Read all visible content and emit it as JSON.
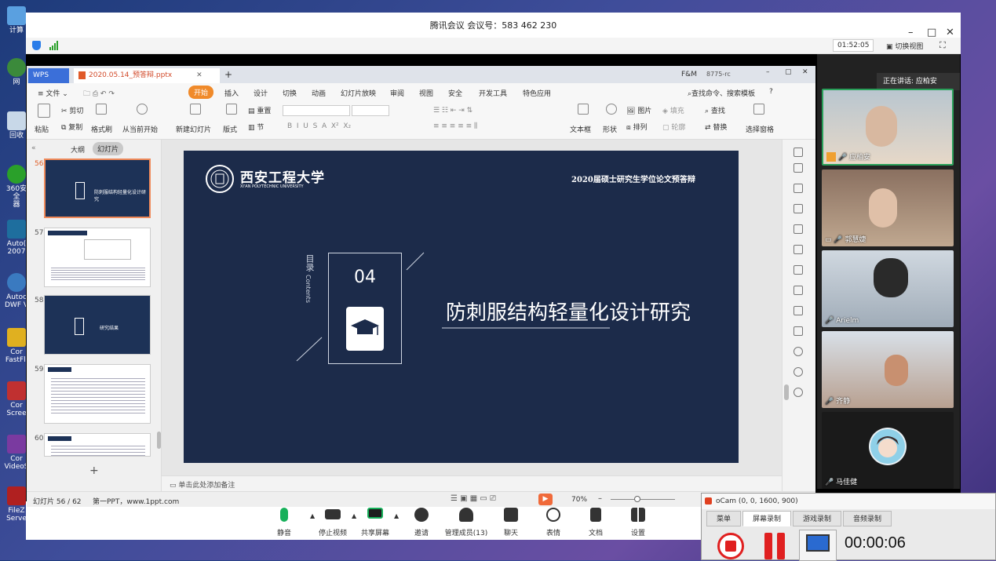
{
  "desktop": {
    "icons": [
      "计算",
      "网",
      "回收",
      "360安全\n器",
      "Auto(\n2007",
      "Autoc\nDWF V",
      "Cor\nFastFli",
      "Cor\nScree",
      "Cor\nVideoS",
      "FileZ\nServe"
    ]
  },
  "meeting": {
    "title": "腾讯会议 会议号：583 462 230",
    "timer": "01:52:05",
    "switch_view": "切换视图",
    "speaking_now": "正在讲话: 应柏安",
    "toolbar": [
      {
        "label": "静音",
        "icon": "microphone-icon"
      },
      {
        "label": "停止视频",
        "icon": "camera-icon"
      },
      {
        "label": "共享屏幕",
        "icon": "share-screen-icon"
      },
      {
        "label": "邀请",
        "icon": "invite-icon"
      },
      {
        "label": "管理成员(13)",
        "icon": "members-icon"
      },
      {
        "label": "聊天",
        "icon": "chat-icon"
      },
      {
        "label": "表情",
        "icon": "emoji-icon"
      },
      {
        "label": "文档",
        "icon": "document-icon"
      },
      {
        "label": "设置",
        "icon": "settings-icon"
      }
    ],
    "participants": [
      "应柏安",
      "郭慧婕",
      "Arielm",
      "齐静",
      "马佳健"
    ]
  },
  "wps": {
    "app_tab": "WPS",
    "file_tab": "2020.05.14_预答辩.pptx",
    "user": "F&M",
    "user_id": "8775-rc",
    "menus": [
      "文件",
      "开始",
      "插入",
      "设计",
      "切换",
      "动画",
      "幻灯片放映",
      "审阅",
      "视图",
      "安全",
      "开发工具",
      "特色应用"
    ],
    "search": "查找命令、搜索模板",
    "ribbon": {
      "paste": "粘贴",
      "cut": "剪切",
      "copy": "复制",
      "format_painter": "格式刷",
      "from_current": "从当前开始",
      "new_slide": "新建幻灯片",
      "layout": "版式",
      "reset": "重置",
      "section": "节",
      "textbox": "文本框",
      "shape": "形状",
      "picture": "图片",
      "arrange": "排列",
      "fill": "填充",
      "outline": "轮廓",
      "find": "查找",
      "replace": "替换",
      "select_pane": "选择窗格"
    },
    "panel_tabs": [
      "大纲",
      "幻灯片"
    ],
    "slide_numbers": [
      "56",
      "57",
      "58",
      "59",
      "60"
    ],
    "thumb_titles": [
      "防刺服结构轻量化设计研究",
      "",
      "研究结果",
      "",
      ""
    ],
    "notes_placeholder": "单击此处添加备注",
    "status": {
      "slide_count": "幻灯片 56 / 62",
      "template": "第一PPT，www.1ppt.com",
      "zoom": "70%"
    }
  },
  "slide": {
    "university_cn": "西安工程大学",
    "university_en": "XI'AN POLYTECHNIC UNIVERSITY",
    "header": "2020届硕士研究生学位论文预答辩",
    "contents_cn": "目录",
    "contents_en": "Contents",
    "number": "04",
    "title": "防刺服结构轻量化设计研究"
  },
  "ocam": {
    "title": "oCam (0, 0, 1600, 900)",
    "tabs": [
      "菜单",
      "屏幕录制",
      "游戏录制",
      "音频录制"
    ],
    "time": "00:00:06"
  }
}
